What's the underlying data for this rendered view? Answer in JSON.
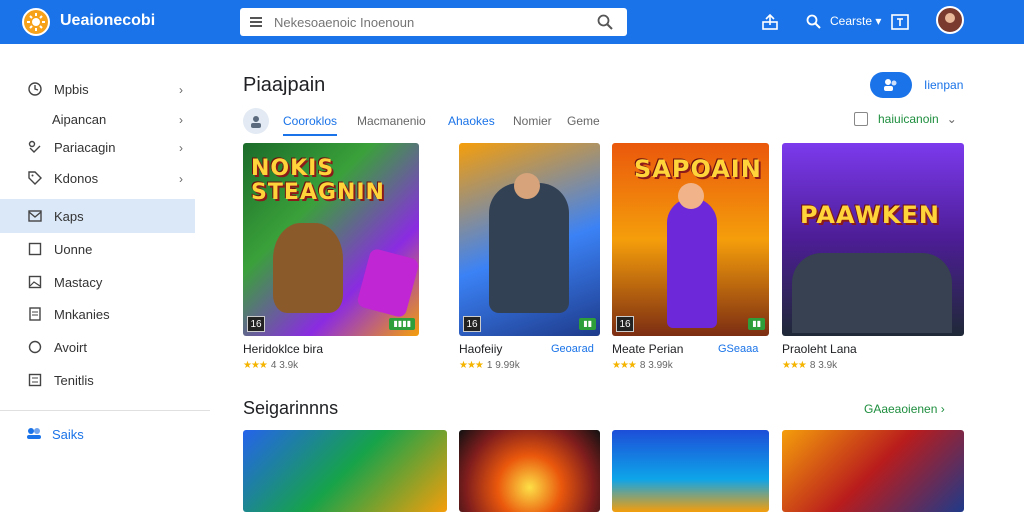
{
  "app": {
    "title": "Ueaionecobi"
  },
  "search": {
    "placeholder": "Nekesoaenoic Inoenoun"
  },
  "topbar": {
    "user_label": "Cearste"
  },
  "sidebar": {
    "items": [
      {
        "label": "Mpbis",
        "icon": "clock-icon"
      },
      {
        "label": "Aipancan",
        "icon": ""
      },
      {
        "label": "Pariacagin",
        "icon": "link-icon"
      },
      {
        "label": "Kdonos",
        "icon": "tag-icon"
      },
      {
        "label": "Kaps",
        "icon": "mail-icon"
      },
      {
        "label": "Uonne",
        "icon": "square-icon"
      },
      {
        "label": "Mastacy",
        "icon": "image-icon"
      },
      {
        "label": "Mnkanies",
        "icon": "doc-icon"
      },
      {
        "label": "Avoirt",
        "icon": "circle-icon"
      },
      {
        "label": "Tenitlis",
        "icon": "list-icon"
      }
    ],
    "sales_label": "Saiks"
  },
  "main": {
    "title": "Piaajpain",
    "top_link": "Iienpan",
    "tabs": [
      "Cooroklos",
      "Macmanenio",
      "Ahaokes",
      "Nomier",
      "Geme"
    ],
    "filter_label": "haiuicanoin"
  },
  "cards": [
    {
      "thumb_title": "NOKIS STEAGNIN",
      "age": "16",
      "name": "Heridoklce bira",
      "tag": "",
      "rating": "4 3.9k"
    },
    {
      "thumb_title": "",
      "age": "16",
      "name": "Haofeiiy",
      "tag": "Geoarad",
      "rating": "1 9.99k"
    },
    {
      "thumb_title": "SAPOAIN",
      "age": "16",
      "name": "Meate Perian",
      "tag": "GSeaaa",
      "rating": "8 3.99k"
    },
    {
      "thumb_title": "PAAWKEN",
      "age": "",
      "name": "Praoleht Lana",
      "tag": "",
      "rating": "8 3.9k"
    }
  ],
  "section2": {
    "title": "Seigarinnns",
    "link": "GAaeaoienen"
  },
  "colors": {
    "brand": "#1a73e8",
    "accent_green": "#1e8e3e",
    "star": "#f4b400"
  }
}
